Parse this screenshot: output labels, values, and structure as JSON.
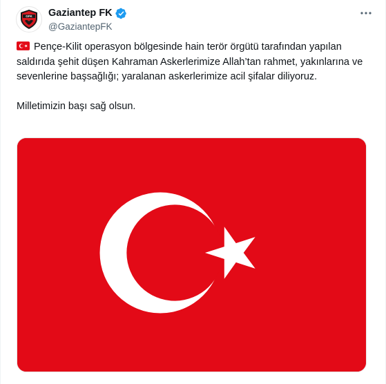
{
  "account": {
    "name": "Gaziantep FK",
    "handle": "@GaziantepFK",
    "verified": true,
    "avatar_icon": "gaziantep-fk-logo"
  },
  "tweet": {
    "lead_emoji": "turkey-flag-emoji",
    "paragraph_1": "Pençe-Kilit operasyon bölgesinde hain terör örgütü tarafından yapılan saldırıda şehit düşen Kahraman Askerlerimize Allah’tan rahmet, yakınlarına ve sevenlerine başsağlığı; yaralanan askerlerimize acil şifalar diliyoruz.",
    "paragraph_2": "Milletimizin başı sağ olsun."
  },
  "media": {
    "type": "image",
    "description_icon": "turkey-flag",
    "flag_red": "#e30a17",
    "flag_white": "#ffffff"
  },
  "colors": {
    "text": "#0f1419",
    "secondary": "#536471",
    "verified_blue": "#1d9bf0"
  }
}
